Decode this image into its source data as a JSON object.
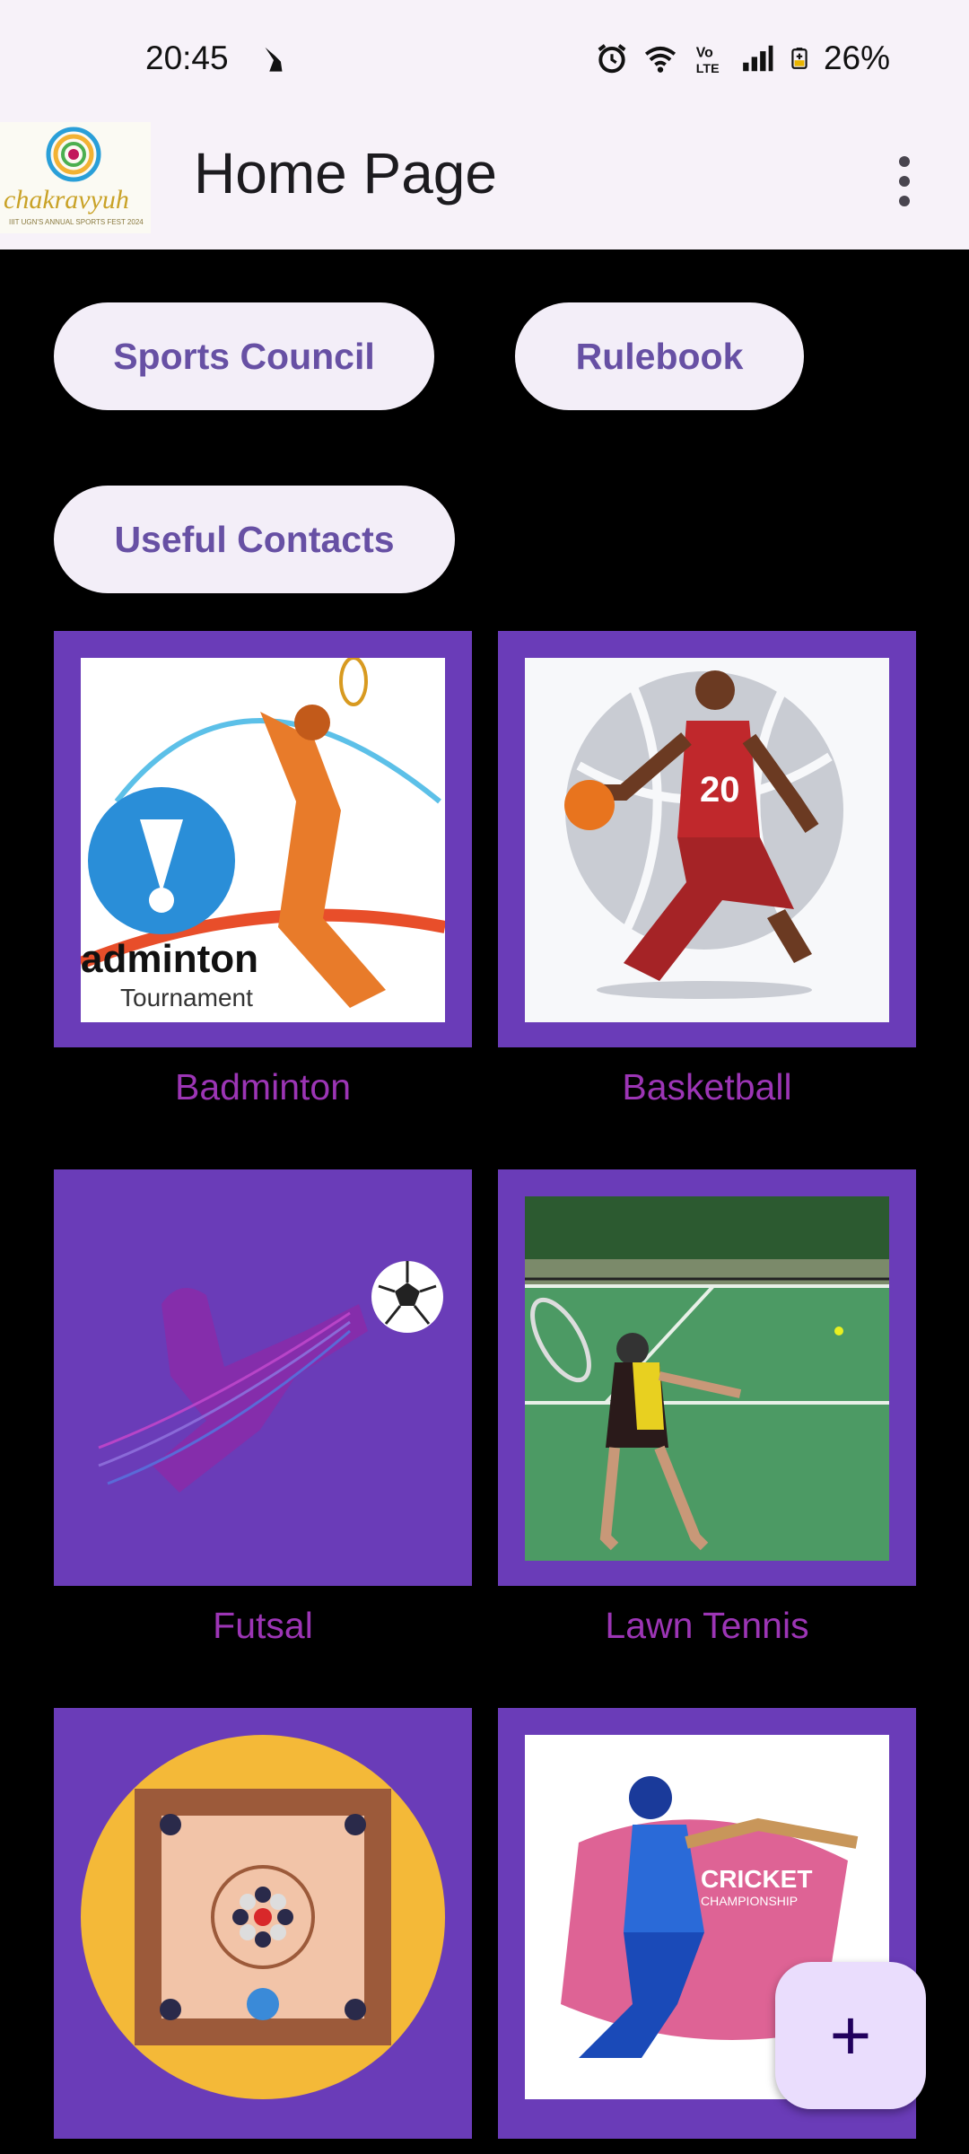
{
  "status_bar": {
    "time": "20:45",
    "battery": "26%",
    "icons": [
      "alarm-icon",
      "wifi-icon",
      "volte-icon",
      "signal-icon",
      "battery-icon"
    ]
  },
  "app_bar": {
    "title": "Home Page",
    "logo_text": "chakravyuh",
    "logo_subtext": "IIIT UGN'S ANNUAL SPORTS FEST 2024"
  },
  "buttons": {
    "sports_council": "Sports Council",
    "rulebook": "Rulebook",
    "useful_contacts": "Useful Contacts"
  },
  "sports": [
    {
      "label": "Badminton",
      "image_text": "adminton",
      "image_subtext": "Tournament"
    },
    {
      "label": "Basketball",
      "jersey_number": "20"
    },
    {
      "label": "Futsal"
    },
    {
      "label": "Lawn Tennis"
    },
    {
      "label": "Carrom"
    },
    {
      "label": "Cricket",
      "image_text": "CRICKET",
      "image_subtext": "CHAMPIONSHIP"
    }
  ],
  "fab": {
    "icon": "plus-icon"
  },
  "colors": {
    "card_bg": "#6a3cb8",
    "label": "#9c35b5",
    "pill_text": "#6750a4",
    "pill_bg": "#f3eef8",
    "app_bar_bg": "#f7f2f9",
    "fab_bg": "#eaddfd"
  }
}
